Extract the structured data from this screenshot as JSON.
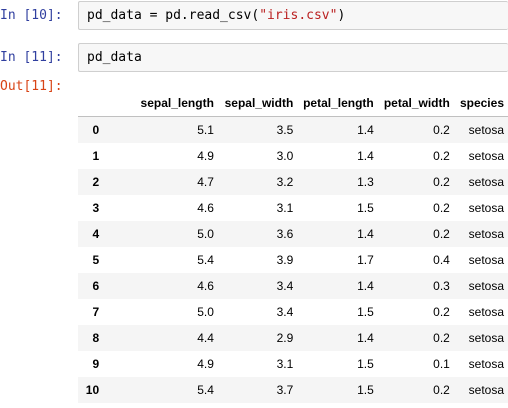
{
  "cells": [
    {
      "in_prompt": "In [10]:",
      "code_before": "pd_data = pd.read_csv(",
      "code_string": "\"iris.csv\"",
      "code_after": ")"
    },
    {
      "in_prompt": "In [11]:",
      "code": "pd_data",
      "out_prompt": "Out[11]:"
    }
  ],
  "dataframe": {
    "columns": [
      "sepal_length",
      "sepal_width",
      "petal_length",
      "petal_width",
      "species"
    ],
    "rows": [
      {
        "index": "0",
        "values": [
          "5.1",
          "3.5",
          "1.4",
          "0.2",
          "setosa"
        ]
      },
      {
        "index": "1",
        "values": [
          "4.9",
          "3.0",
          "1.4",
          "0.2",
          "setosa"
        ]
      },
      {
        "index": "2",
        "values": [
          "4.7",
          "3.2",
          "1.3",
          "0.2",
          "setosa"
        ]
      },
      {
        "index": "3",
        "values": [
          "4.6",
          "3.1",
          "1.5",
          "0.2",
          "setosa"
        ]
      },
      {
        "index": "4",
        "values": [
          "5.0",
          "3.6",
          "1.4",
          "0.2",
          "setosa"
        ]
      },
      {
        "index": "5",
        "values": [
          "5.4",
          "3.9",
          "1.7",
          "0.4",
          "setosa"
        ]
      },
      {
        "index": "6",
        "values": [
          "4.6",
          "3.4",
          "1.4",
          "0.3",
          "setosa"
        ]
      },
      {
        "index": "7",
        "values": [
          "5.0",
          "3.4",
          "1.5",
          "0.2",
          "setosa"
        ]
      },
      {
        "index": "8",
        "values": [
          "4.4",
          "2.9",
          "1.4",
          "0.2",
          "setosa"
        ]
      },
      {
        "index": "9",
        "values": [
          "4.9",
          "3.1",
          "1.5",
          "0.1",
          "setosa"
        ]
      },
      {
        "index": "10",
        "values": [
          "5.4",
          "3.7",
          "1.5",
          "0.2",
          "setosa"
        ]
      }
    ]
  },
  "colors": {
    "in_prompt": "#303f9f",
    "out_prompt": "#d84315",
    "string_literal": "#ba2121",
    "cell_bg": "#f7f7f7"
  }
}
